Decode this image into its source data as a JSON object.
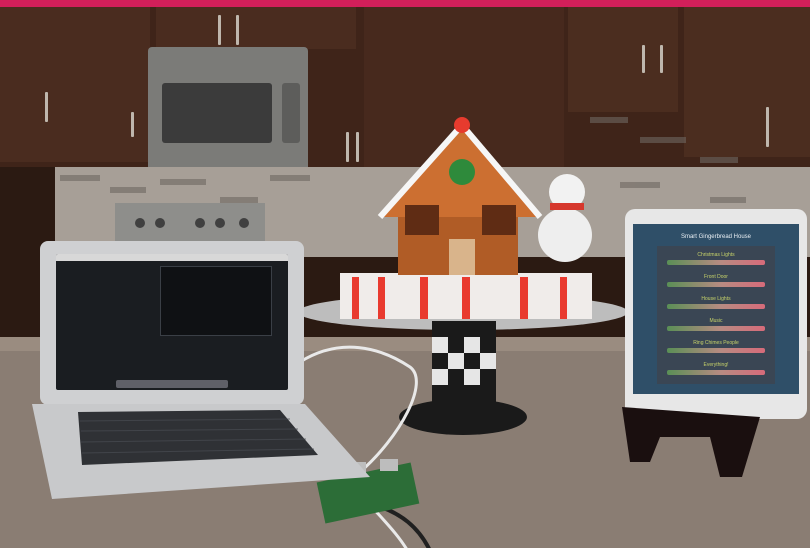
{
  "scene": {
    "top_bar_color": "#d21f5a",
    "laptop": {
      "menubar_color": "#d8d8d8"
    },
    "ipad": {
      "title": "Smart Gingerbread House",
      "buttons": [
        {
          "label": "Christmas Lights"
        },
        {
          "label": "Front Door"
        },
        {
          "label": "House Lights"
        },
        {
          "label": "Music"
        },
        {
          "label": "Ring Chimes People"
        },
        {
          "label": "Everything!"
        }
      ]
    }
  }
}
